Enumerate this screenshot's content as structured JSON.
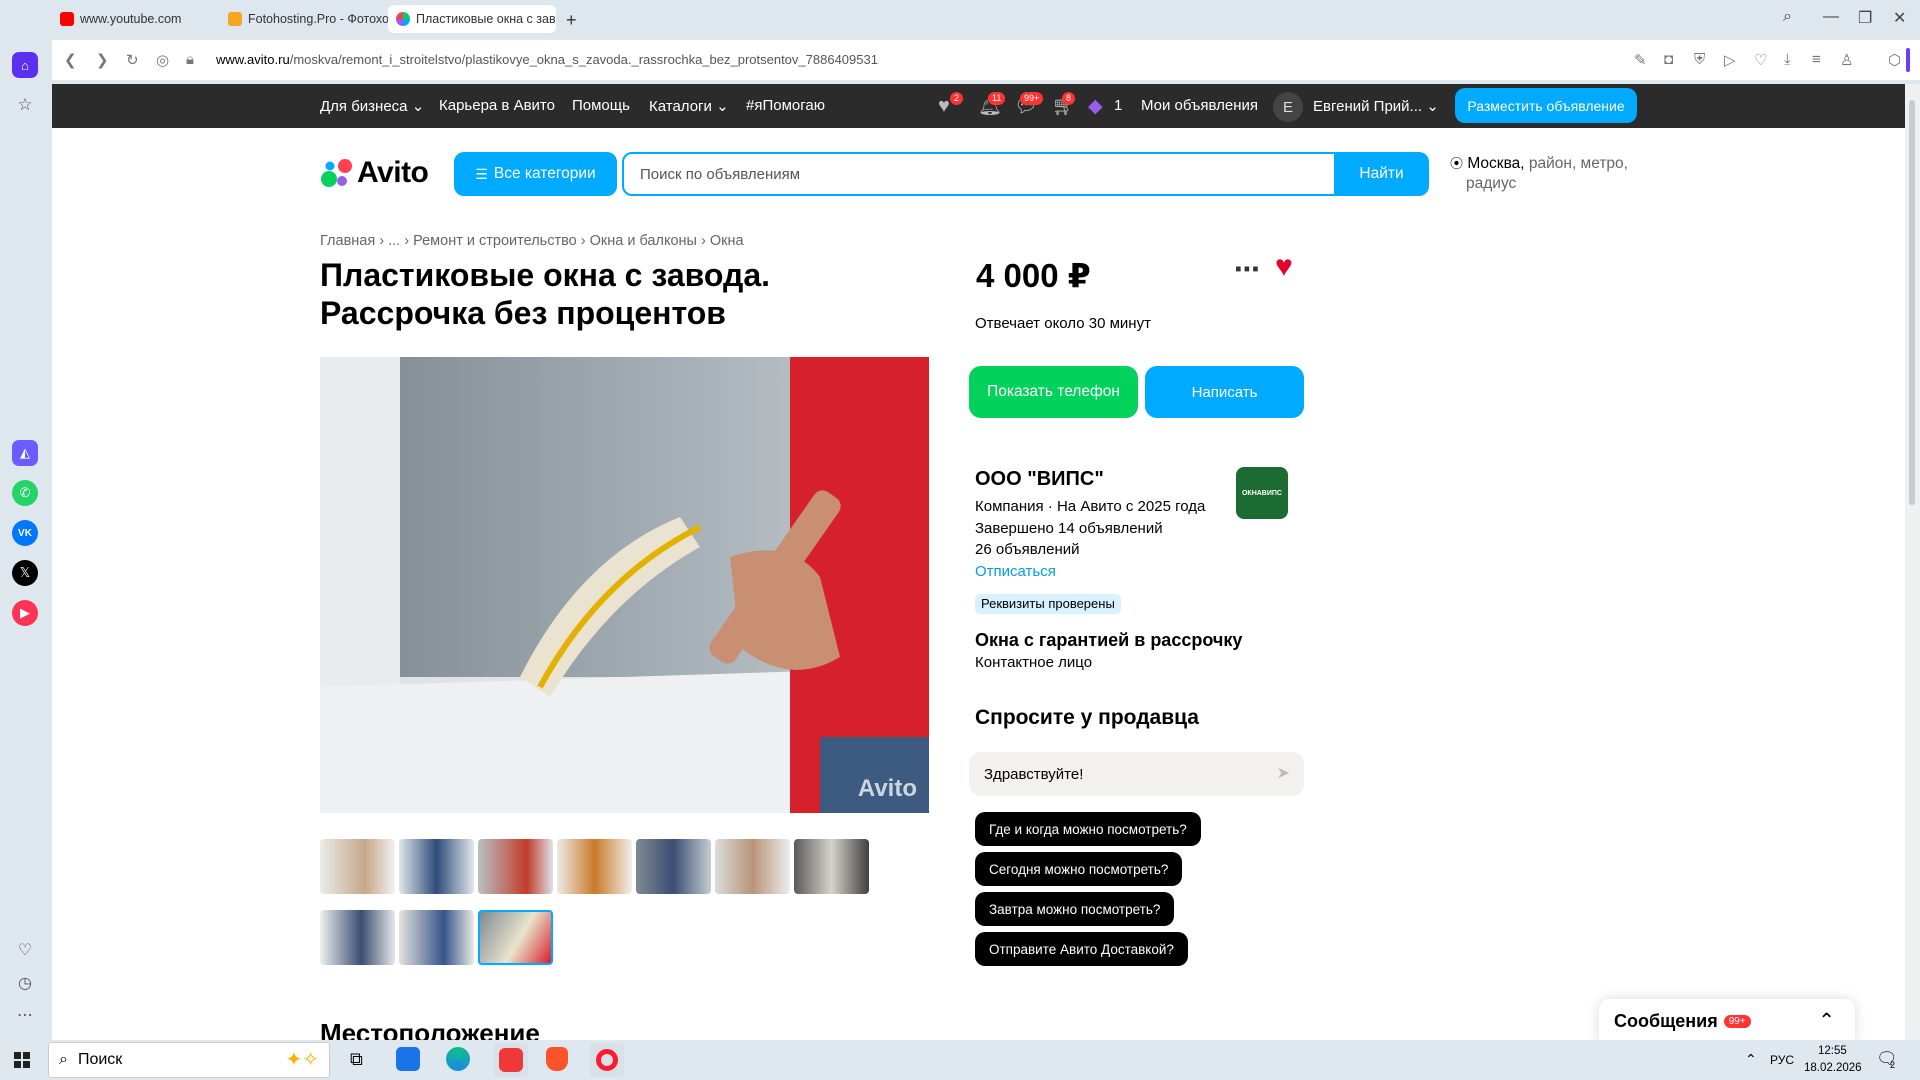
{
  "browser": {
    "tabs": [
      {
        "label": "www.youtube.com"
      },
      {
        "label": "Fotohosting.Pro - Фотохо"
      },
      {
        "label": "Пластиковые окна с завод"
      }
    ],
    "url_host": "www.avito.ru",
    "url_path": "/moskva/remont_i_stroitelstvo/plastikovye_okna_s_zavoda._rassrochka_bez_protsentov_7886409531"
  },
  "topnav": {
    "for_business": "Для бизнеса",
    "career": "Карьера в Авито",
    "help": "Помощь",
    "catalogs": "Каталоги",
    "ya_pomogayu": "#яПомогаю",
    "badges": {
      "favorites": "2",
      "notifications": "11",
      "messages": "99+",
      "cart": "8"
    },
    "bonus_count": "1",
    "my_ads": "Мои объявления",
    "avatar_letter": "Е",
    "user_name": "Евгений Прий...",
    "post_ad": "Разместить объявление"
  },
  "header": {
    "logo": "Avito",
    "all_categories": "Все категории",
    "search_placeholder": "Поиск по объявлениям",
    "search_button": "Найти",
    "location_city": "Москва,",
    "location_rest": " район, метро,",
    "location_rest2": "радиус"
  },
  "breadcrumb": [
    "Главная",
    "...",
    "Ремонт и строительство",
    "Окна и балконы",
    "Окна"
  ],
  "listing": {
    "title": "Пластиковые окна с завода. Рассрочка без процентов",
    "price": "4 000 ₽",
    "response_time": "Отвечает около 30 минут",
    "show_phone": "Показать телефон",
    "write": "Написать",
    "watermark": "Avito"
  },
  "seller": {
    "name": "ООО \"ВИПС\"",
    "info": "Компания · На Авито с 2025 года",
    "completed": "Завершено 14 объявлений",
    "ads_count": "26 объявлений",
    "unsubscribe": "Отписаться",
    "verified": "Реквизиты проверены",
    "shop_name": "Окна с гарантией в рассрочку",
    "contact_role": "Контактное лицо",
    "logo_text": "ОКНАВИПС"
  },
  "ask": {
    "heading": "Спросите у продавца",
    "input_value": "Здравствуйте!",
    "chips": [
      "Где и когда можно посмотреть?",
      "Сегодня можно посмотреть?",
      "Завтра можно посмотреть?",
      "Отправите Авито Доставкой?"
    ]
  },
  "location_heading": "Местоположение",
  "messages_panel": {
    "label": "Сообщения",
    "badge": "99+"
  },
  "taskbar": {
    "search": "Поиск",
    "lang": "РУС",
    "time": "12:55",
    "date": "18.02.2026",
    "notif_count": "2"
  },
  "colors": {
    "accent": "#00aaff",
    "green": "#02d15c",
    "fav_red": "#e4002b"
  }
}
